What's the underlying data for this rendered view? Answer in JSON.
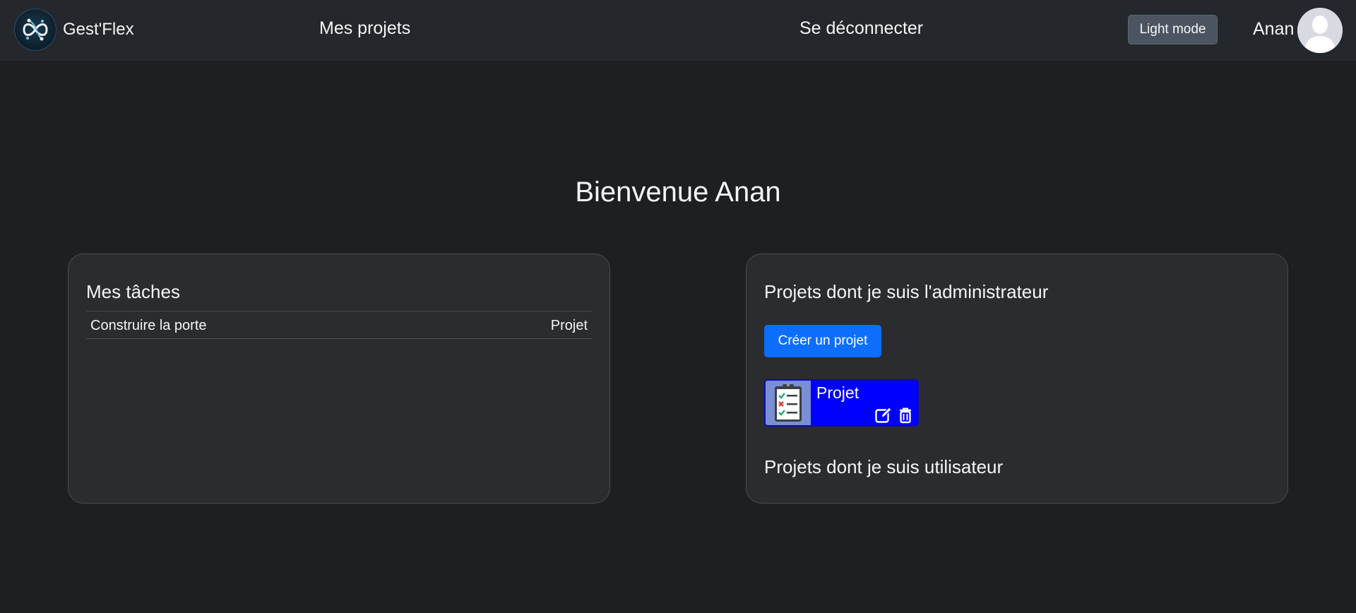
{
  "navbar": {
    "brand_name": "Gest'Flex",
    "projects_link": "Mes projets",
    "logout_link": "Se déconnecter",
    "mode_button": "Light mode",
    "user_name": "Anan"
  },
  "main": {
    "welcome": "Bienvenue Anan"
  },
  "tasks_card": {
    "title": "Mes tâches",
    "rows": [
      {
        "task": "Construire la porte",
        "project": "Projet"
      }
    ]
  },
  "projects_card": {
    "admin_title": "Projets dont je suis l'administrateur",
    "create_button": "Créer un projet",
    "admin_projects": [
      {
        "name": "Projet"
      }
    ],
    "user_title": "Projets dont je suis utilisateur"
  },
  "colors": {
    "background": "#1e1f22",
    "navbar": "#24272b",
    "card": "#2b2c2f",
    "primary": "#0d6efd",
    "project_card": "#0000ff"
  },
  "icons": [
    "infinity-logo-icon",
    "user-avatar-icon",
    "checklist-icon",
    "edit-icon",
    "trash-icon"
  ]
}
